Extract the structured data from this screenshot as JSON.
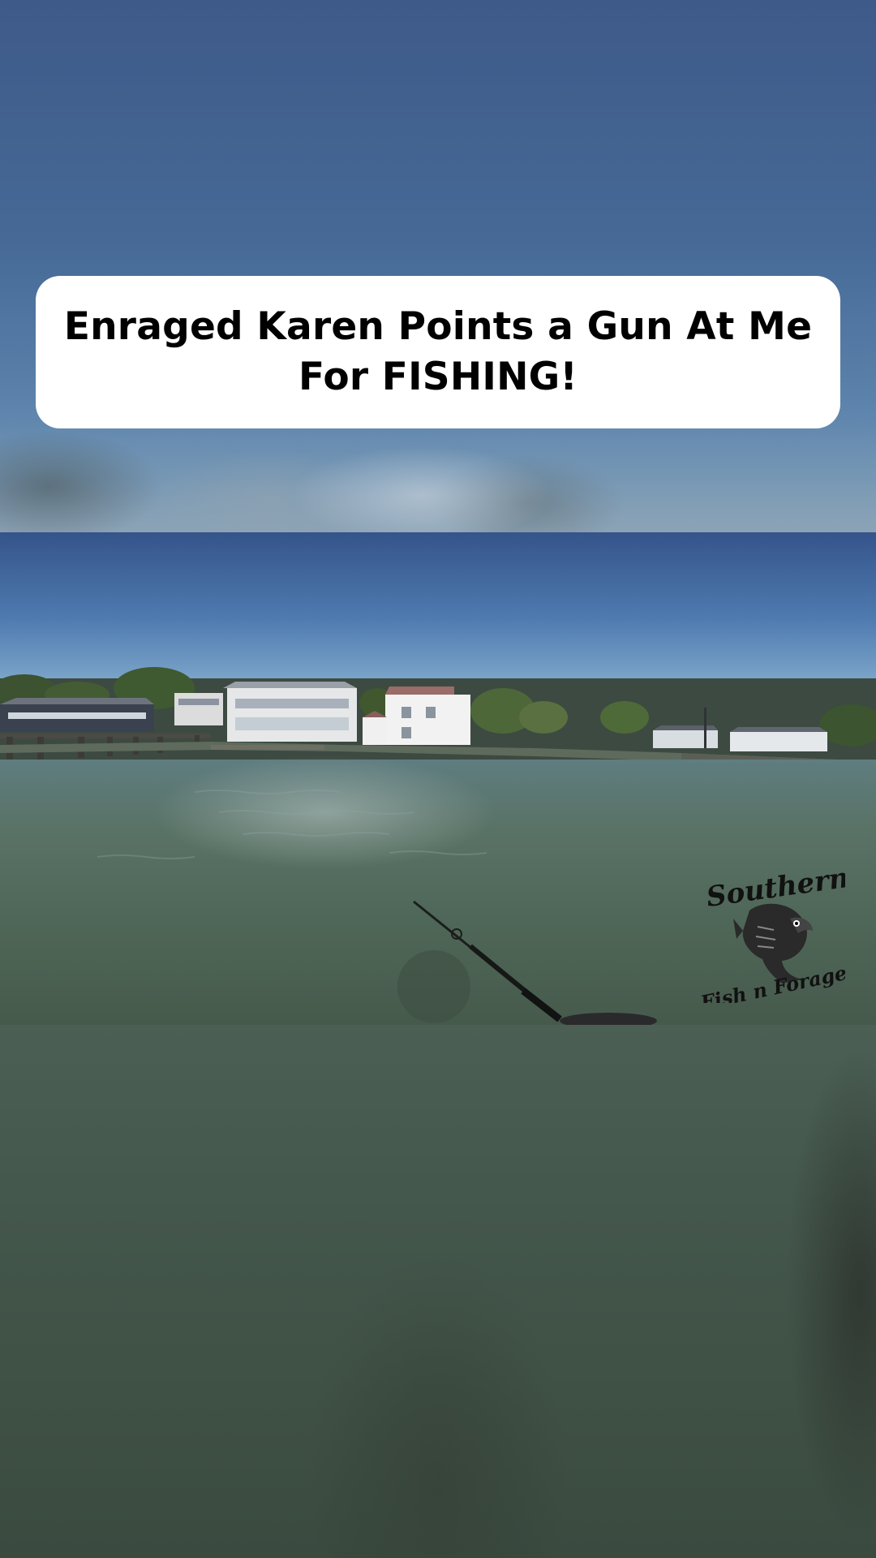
{
  "video": {
    "title_line1": "Enraged Karen Points a Gun At Me",
    "title_line2": "For FISHING!"
  },
  "watermark": {
    "brand_line1": "Southern",
    "brand_line2": "Fish n Forage",
    "icon": "bass-fish-icon"
  },
  "colors": {
    "sky": "#3f5f92",
    "water": "#4a5f55",
    "card": "#ffffff",
    "title_text": "#000000"
  }
}
